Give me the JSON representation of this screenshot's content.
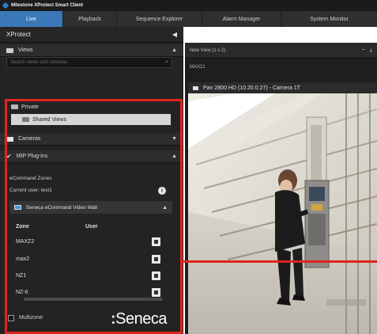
{
  "window": {
    "title": "Milestone XProtect Smart Client"
  },
  "tabs": [
    {
      "label": "Live",
      "active": true
    },
    {
      "label": "Playback",
      "active": false
    },
    {
      "label": "Sequence Explorer",
      "active": false
    },
    {
      "label": "Alarm Manager",
      "active": false
    },
    {
      "label": "System Monitor",
      "active": false
    }
  ],
  "left_panel": {
    "header": "XProtect",
    "views_label": "Views",
    "search_placeholder": "Search views and cameras",
    "tree": [
      {
        "label": "Private",
        "selected": false
      },
      {
        "label": "Shared Views",
        "selected": true
      }
    ],
    "cameras_label": "Cameras",
    "mip_label": "MIP Plug-ins",
    "ecommand_zones": "eCommand Zones",
    "current_user": "Current user: test1",
    "video_wall_label": "Seneca eCommand Video Wall",
    "zone_header": "Zone",
    "user_header": "User",
    "zones": [
      "MAXZ2",
      "max2",
      "NZ1",
      "NZ-6"
    ],
    "multizone_label": "Multizone",
    "brand": "Seneca"
  },
  "view_panel": {
    "dropdown": "New View (1 x 2)",
    "view_name": "MAX21",
    "camera_label": "Pan 2800 HD (10.20.0.27) - Camera 1T"
  },
  "colors": {
    "accent": "#3a78b8",
    "highlight": "#e0241e",
    "panel": "#232323"
  }
}
